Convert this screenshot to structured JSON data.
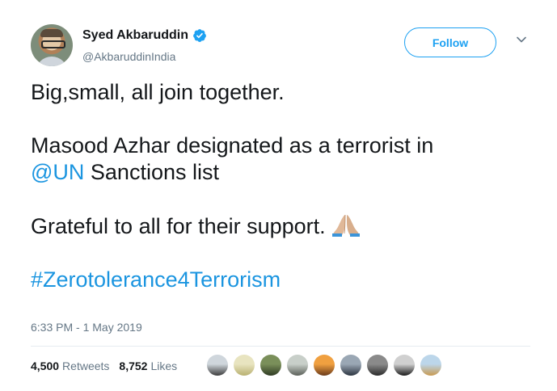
{
  "author": {
    "name": "Syed Akbaruddin",
    "handle": "@AkbaruddinIndia",
    "verified": true
  },
  "follow_label": "Follow",
  "tweet": {
    "line1": "Big,small, all join together.",
    "line2": "Masood Azhar designated as a terrorist in",
    "mention": "@UN",
    "line3_rest": " Sanctions list",
    "line4": "Grateful to all for their support.",
    "emoji": "folded-hands-emoji",
    "hashtag": "#Zerotolerance4Terrorism"
  },
  "timestamp": "6:33 PM - 1 May 2019",
  "stats": {
    "retweets_count": "4,500",
    "retweets_label": "Retweets",
    "likes_count": "8,752",
    "likes_label": "Likes"
  },
  "likers": [
    {
      "color_top": "#cfd6dc",
      "color_bottom": "#3b3b3b"
    },
    {
      "color_top": "#e8e4c0",
      "color_bottom": "#b8b070"
    },
    {
      "color_top": "#7a8f5a",
      "color_bottom": "#2e3a22"
    },
    {
      "color_top": "#c8cfc9",
      "color_bottom": "#5a5f58"
    },
    {
      "color_top": "#f0a040",
      "color_bottom": "#6a3a1a"
    },
    {
      "color_top": "#9aa7b4",
      "color_bottom": "#2b3440"
    },
    {
      "color_top": "#8a8a8a",
      "color_bottom": "#2a2a2a"
    },
    {
      "color_top": "#d0d0d0",
      "color_bottom": "#1a1a1a"
    },
    {
      "color_top": "#bcd6ea",
      "color_bottom": "#c89a50"
    }
  ],
  "colors": {
    "accent": "#1da1f2",
    "link": "#1b95e0",
    "muted": "#657786"
  }
}
